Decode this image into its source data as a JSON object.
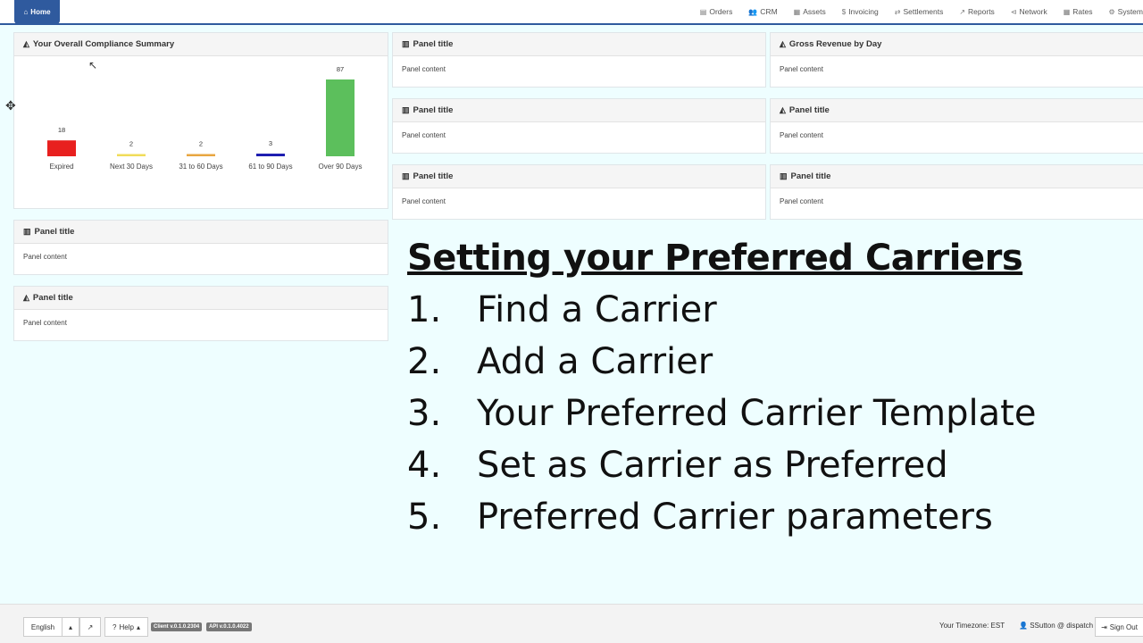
{
  "nav": {
    "home_label": "Home",
    "items": [
      {
        "icon": "document-icon",
        "glyph": "▤",
        "label": "Orders"
      },
      {
        "icon": "users-icon",
        "glyph": "👥",
        "label": "CRM"
      },
      {
        "icon": "building-icon",
        "glyph": "▦",
        "label": "Assets"
      },
      {
        "icon": "dollar-icon",
        "glyph": "$",
        "label": "Invoicing"
      },
      {
        "icon": "exchange-icon",
        "glyph": "⇄",
        "label": "Settlements"
      },
      {
        "icon": "line-chart-icon",
        "glyph": "📈",
        "label": "Reports"
      },
      {
        "icon": "share-icon",
        "glyph": "⊲",
        "label": "Network"
      },
      {
        "icon": "table-icon",
        "glyph": "▦",
        "label": "Rates"
      },
      {
        "icon": "gear-icon",
        "glyph": "⚙",
        "label": "System"
      }
    ]
  },
  "panels": {
    "compliance": {
      "title": "Your Overall Compliance Summary"
    },
    "p1": {
      "title": "Panel title",
      "content": "Panel content"
    },
    "gross": {
      "title": "Gross Revenue by Day",
      "content": "Panel content"
    },
    "p2": {
      "title": "Panel title",
      "content": "Panel content"
    },
    "p3": {
      "title": "Panel title",
      "content": "Panel content"
    },
    "p4": {
      "title": "Panel title",
      "content": "Panel content"
    },
    "p5": {
      "title": "Panel title",
      "content": "Panel content"
    },
    "left1": {
      "title": "Panel title",
      "content": "Panel content"
    },
    "left2": {
      "title": "Panel title",
      "content": "Panel content"
    }
  },
  "chart_data": {
    "type": "bar",
    "title": "Your Overall Compliance Summary",
    "categories": [
      "Expired",
      "Next 30 Days",
      "31 to 60 Days",
      "61 to 90 Days",
      "Over 90 Days"
    ],
    "values": [
      18,
      2,
      2,
      3,
      87
    ],
    "colors": [
      "#e8201f",
      "#f0dc5a",
      "#e8a640",
      "#1c1cb0",
      "#5cbf5c"
    ],
    "ylim": [
      0,
      87
    ],
    "xlabel": "",
    "ylabel": "",
    "grid": false
  },
  "overlay": {
    "title": "Setting your Preferred Carriers",
    "steps": [
      {
        "num": "1.",
        "text": "Find a Carrier"
      },
      {
        "num": "2.",
        "text": "Add a Carrier"
      },
      {
        "num": "3.",
        "text": "Your Preferred Carrier Template"
      },
      {
        "num": "4.",
        "text": "Set as Carrier as Preferred"
      },
      {
        "num": "5.",
        "text": "Preferred Carrier parameters"
      }
    ]
  },
  "footer": {
    "language": "English",
    "help": "Help",
    "client_version": "Client v.0.1.0.2304",
    "api_version": "API v.0.1.0.4022",
    "timezone": "Your Timezone: EST",
    "user": "SSutton @ dispatch",
    "signout": "Sign Out"
  }
}
